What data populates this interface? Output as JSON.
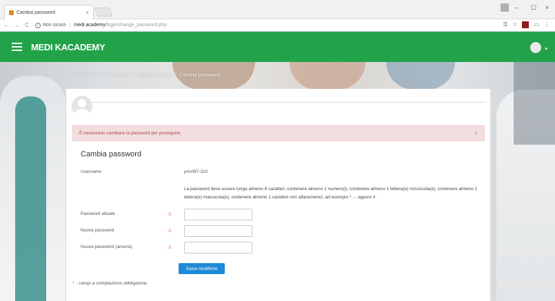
{
  "browser": {
    "tab_title": "Cambia password",
    "tab_close": "×",
    "user_badge": "",
    "win_min": "–",
    "win_max": "☐",
    "win_close": "×",
    "back": "←",
    "forward": "→",
    "reload": "C",
    "security_label": "Non sicuro",
    "separator": "|",
    "url_host": "medi.academy",
    "url_path": "/login/change_password.php",
    "bookmark_star": "☆",
    "ext_red": "",
    "menu": "⋮"
  },
  "header": {
    "brand": "MEDI KACADEMY"
  },
  "breadcrumb": {
    "items": [
      "Dashboard",
      "Preferenze",
      "Account utente",
      "Cambia password"
    ],
    "separator": "/"
  },
  "alert": {
    "message": "È necessario cambiare la password per proseguire.",
    "close": "×"
  },
  "form": {
    "title": "Cambia password",
    "username_label": "Username",
    "username_value": "priv087-310",
    "hint": "La password deve essere lunga almeno 8 caratteri, contenere almeno 1 numero(i), contenere almeno 1 lettera(e) minuscola(e), contenere almeno 1 lettera(e) maiuscola(e), contenere almeno 1 caratteri non alfanumerici, ad esempio *, -, oppure #.",
    "current_label": "Password attuale",
    "new_label": "Nuova password",
    "confirm_label": "Nuova password (ancora)",
    "required_mark": "⚠",
    "save_label": "Salva modifiche",
    "required_note_star": "*",
    "required_note": "- campi a compilazione obbligatoria"
  }
}
